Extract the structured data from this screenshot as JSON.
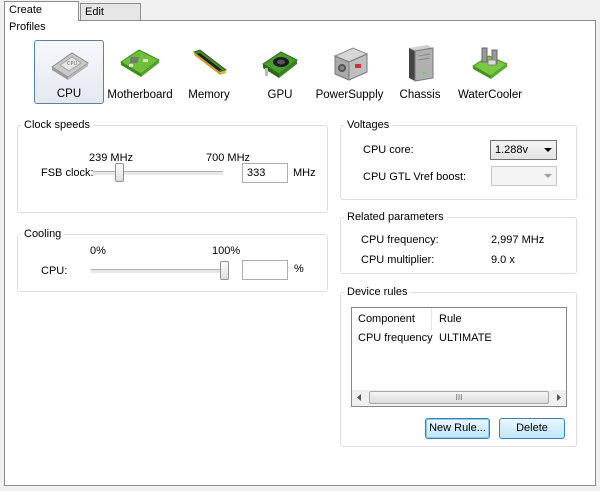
{
  "tabs": [
    {
      "label": "Create Profiles",
      "active": true
    },
    {
      "label": "Edit Profiles",
      "active": false
    }
  ],
  "toolbar": {
    "items": [
      {
        "label": "CPU",
        "icon": "cpu-icon",
        "selected": true
      },
      {
        "label": "Motherboard",
        "icon": "motherboard-icon"
      },
      {
        "label": "Memory",
        "icon": "memory-icon"
      },
      {
        "label": "GPU",
        "icon": "gpu-icon"
      },
      {
        "label": "PowerSupply",
        "icon": "power-supply-icon"
      },
      {
        "label": "Chassis",
        "icon": "chassis-icon"
      },
      {
        "label": "WaterCooler",
        "icon": "water-cooler-icon"
      }
    ]
  },
  "clock": {
    "title": "Clock speeds",
    "min_label": "239 MHz",
    "max_label": "700 MHz",
    "fsb_label": "FSB clock:",
    "value": "333",
    "unit": "MHz",
    "slider_fraction": 0.2
  },
  "cooling": {
    "title": "Cooling",
    "min_label": "0%",
    "max_label": "100%",
    "cpu_label": "CPU:",
    "value": "",
    "unit": "%",
    "slider_fraction": 1.0
  },
  "voltages": {
    "title": "Voltages",
    "cpu_core_label": "CPU core:",
    "cpu_core_value": "1.288v",
    "gtl_label": "CPU GTL Vref boost:",
    "gtl_value": ""
  },
  "related": {
    "title": "Related parameters",
    "freq_label": "CPU frequency:",
    "freq_value": "2,997 MHz",
    "mult_label": "CPU multiplier:",
    "mult_value": "9.0 x"
  },
  "rules": {
    "title": "Device rules",
    "col_component": "Component",
    "col_rule": "Rule",
    "rows": [
      {
        "component": "CPU frequency",
        "rule": "ULTIMATE"
      }
    ],
    "scroll_thumb_glyph": "III",
    "new_rule_label": "New Rule...",
    "delete_label": "Delete"
  }
}
